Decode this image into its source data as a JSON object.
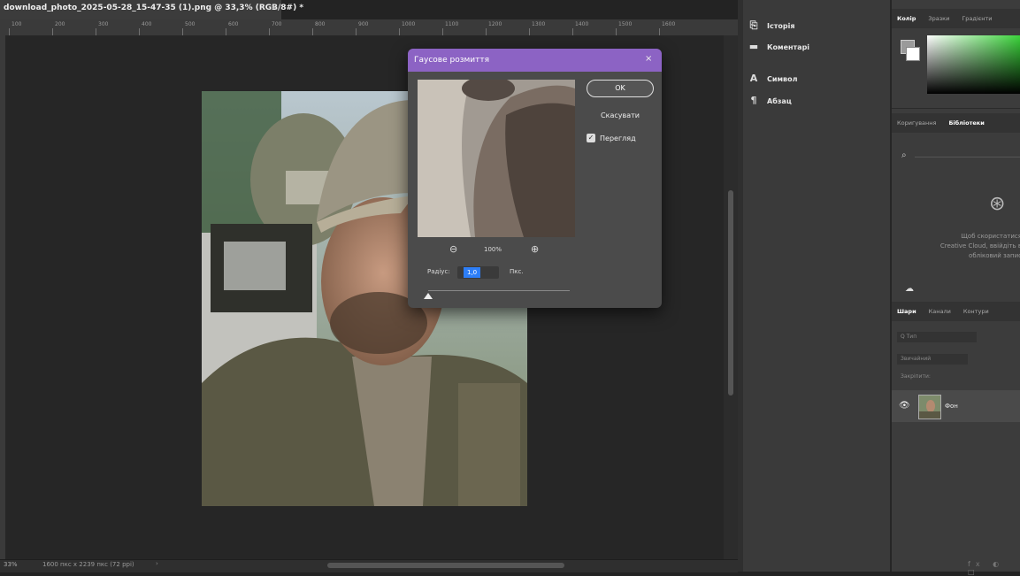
{
  "document": {
    "tab_title": "download_photo_2025-05-28_15-47-35 (1).png @ 33,3% (RGB/8#) *",
    "close": "×",
    "ruler_numbers": [
      "100",
      "200",
      "300",
      "400",
      "500",
      "600",
      "700",
      "800",
      "900",
      "1000",
      "1100",
      "1200",
      "1300",
      "1400",
      "1500",
      "1600"
    ]
  },
  "status_bar": {
    "zoom": "33%",
    "doc_size": "1600 пкс x 2239 пкс (72 ppi)",
    "arrow": "›"
  },
  "mid_panel": {
    "items": [
      {
        "label": "Історія",
        "icon": "history-icon"
      },
      {
        "label": "Коментарі",
        "icon": "comments-icon"
      },
      {
        "label": "Символ",
        "icon": "character-icon"
      },
      {
        "label": "Абзац",
        "icon": "paragraph-icon"
      }
    ]
  },
  "right_panel": {
    "color_tabs": [
      "Колір",
      "Зразки",
      "Градієнти"
    ],
    "lib_tabs": [
      "Коригування",
      "Бібліотеки"
    ],
    "libraries_message": "Щоб скористатися Creative Cloud, ввійдіть в обліковий запис",
    "layers_tabs": [
      "Шари",
      "Канали",
      "Контури"
    ],
    "layer_search": "Q Тип",
    "blend_mode": "Звичайний",
    "lock_label": "Закріпити:",
    "layer_name": "Фон",
    "colors": {
      "foreground": "#9a9a9a",
      "background": "#ffffff",
      "hue": "#3bd33b"
    }
  },
  "dialog": {
    "title": "Гаусове розмиття",
    "close": "×",
    "ok_label": "OK",
    "cancel_label": "Скасувати",
    "preview_label": "Перегляд",
    "preview_checked": true,
    "zoom_percent": "100%",
    "radius_label": "Радіус:",
    "radius_value": "1,0",
    "radius_unit": "Пкс.",
    "accent_color": "#8c63c4"
  }
}
